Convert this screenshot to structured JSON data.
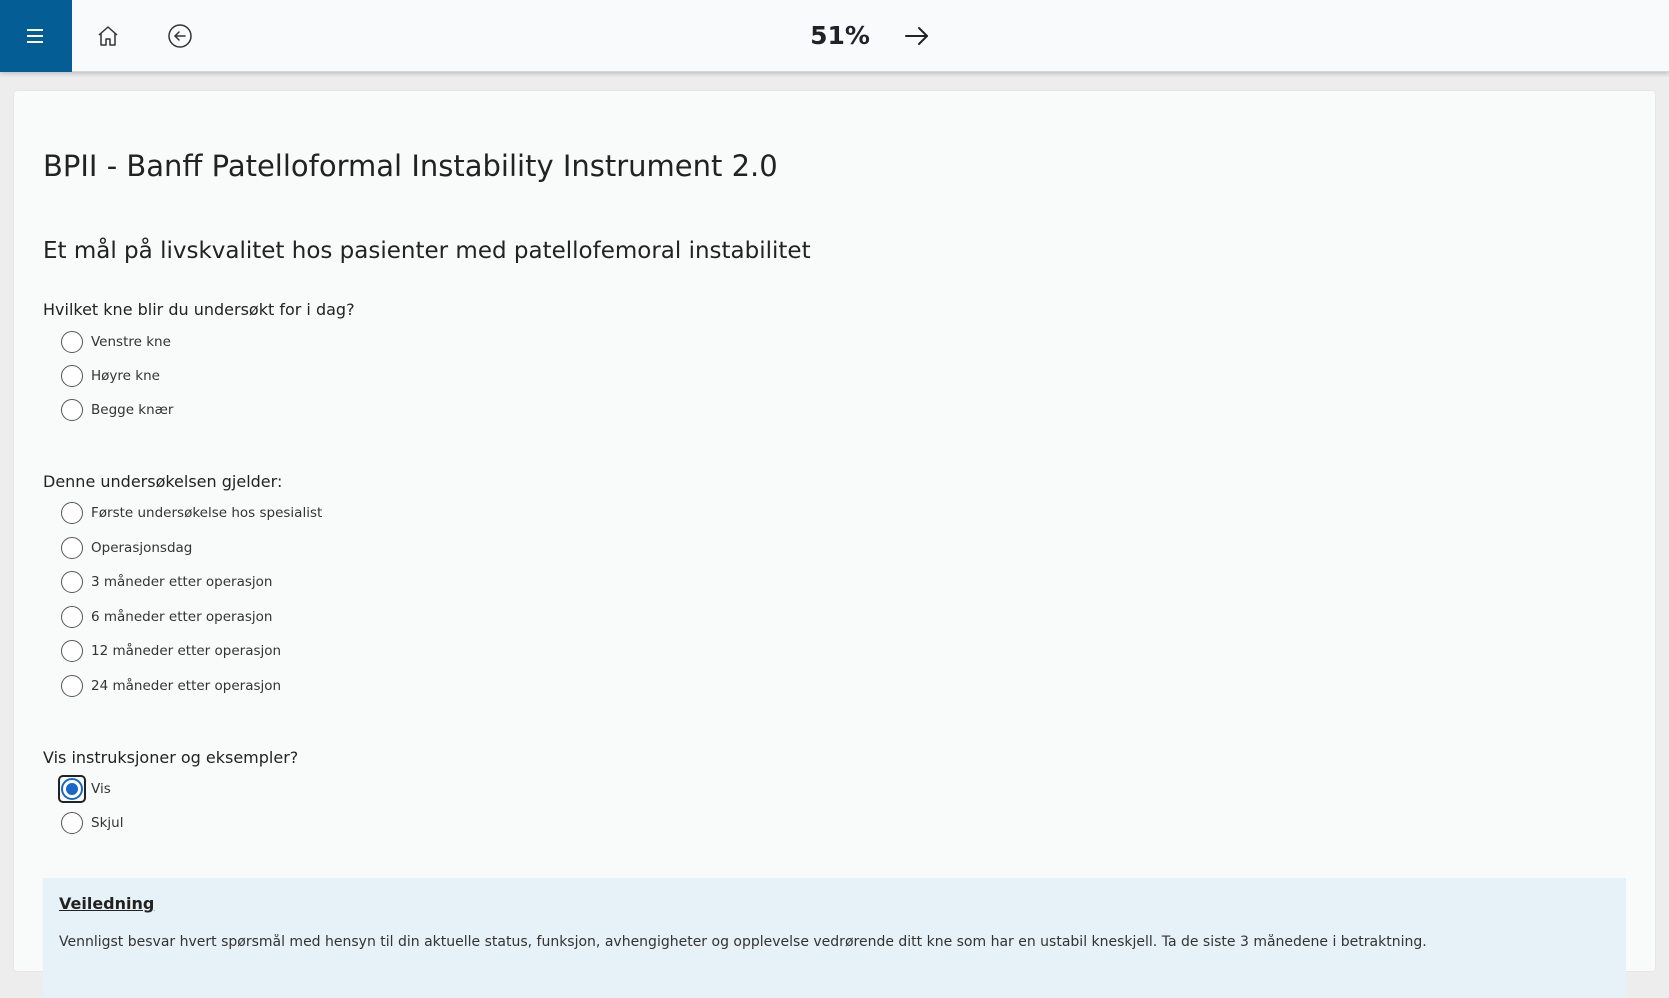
{
  "header": {
    "progress": "51%"
  },
  "form": {
    "title": "BPII - Banff Patelloformal Instability Instrument 2.0",
    "subtitle": "Et mål på livskvalitet hos pasienter med patellofemoral instabilitet",
    "q1": {
      "label": "Hvilket kne blir du undersøkt for i dag?",
      "options": [
        "Venstre kne",
        "Høyre kne",
        "Begge knær"
      ]
    },
    "q2": {
      "label": "Denne undersøkelsen gjelder:",
      "options": [
        "Første undersøkelse hos spesialist",
        "Operasjonsdag",
        "3 måneder etter operasjon",
        "6 måneder etter operasjon",
        "12 måneder etter operasjon",
        "24 måneder etter operasjon"
      ]
    },
    "q3": {
      "label": "Vis instruksjoner og eksempler?",
      "options": [
        "Vis",
        "Skjul"
      ],
      "selected": "Vis"
    }
  },
  "guide": {
    "title": "Veiledning",
    "text": "Vennligst besvar hvert spørsmål med hensyn til din aktuelle status, funksjon, avhengigheter og opplevelse vedrørende ditt kne som har en ustabil kneskjell. Ta de siste 3 månedene i betraktning."
  },
  "colors": {
    "menu_bg": "#045d94",
    "accent": "#1a66c9",
    "guide_bg": "#e7f1f8"
  },
  "icons": {
    "menu": "hamburger-icon",
    "home": "home-icon",
    "back": "circle-arrow-left-icon",
    "next": "arrow-right-icon"
  }
}
